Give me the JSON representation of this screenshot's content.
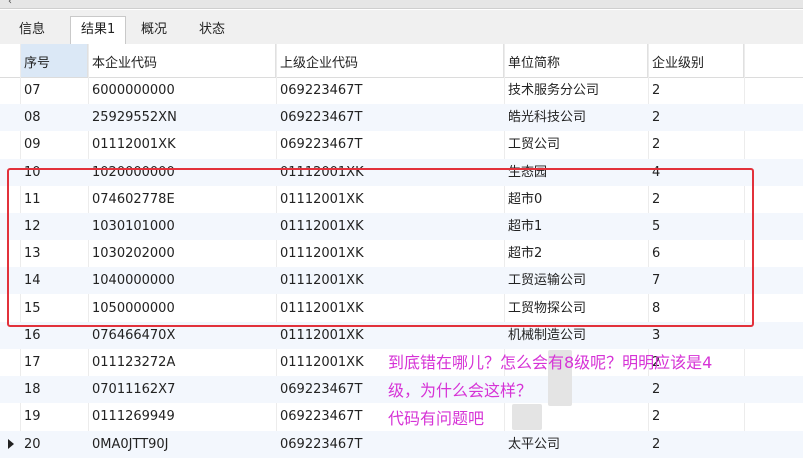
{
  "tabs": [
    {
      "label": "信息",
      "active": false
    },
    {
      "label": "结果1",
      "active": true
    },
    {
      "label": "概况",
      "active": false
    },
    {
      "label": "状态",
      "active": false
    }
  ],
  "table": {
    "columns": [
      "序号",
      "本企业代码",
      "上级企业代码",
      "单位简称",
      "企业级别"
    ],
    "rows": [
      [
        "07",
        "6000000000",
        "069223467T",
        "技术服务分公司",
        "2"
      ],
      [
        "08",
        "25929552XN",
        "069223467T",
        "皓光科技公司",
        "2"
      ],
      [
        "09",
        "01112001XK",
        "069223467T",
        "工贸公司",
        "2"
      ],
      [
        "10",
        "1020000000",
        "01112001XK",
        "生态园",
        "4"
      ],
      [
        "11",
        "074602778E",
        "01112001XK",
        "超市0",
        "2"
      ],
      [
        "12",
        "1030101000",
        "01112001XK",
        "超市1",
        "5"
      ],
      [
        "13",
        "1030202000",
        "01112001XK",
        "超市2",
        "6"
      ],
      [
        "14",
        "1040000000",
        "01112001XK",
        "工贸运输公司",
        "7"
      ],
      [
        "15",
        "1050000000",
        "01112001XK",
        "工贸物探公司",
        "8"
      ],
      [
        "16",
        "076466470X",
        "01112001XK",
        "机械制造公司",
        "3"
      ],
      [
        "17",
        "011123272A",
        "01112001XK",
        "",
        "2"
      ],
      [
        "18",
        "07011162X7",
        "069223467T",
        "",
        "2"
      ],
      [
        "19",
        "0111269949",
        "069223467T",
        "",
        "2"
      ],
      [
        "20",
        "0MA0JTT90J",
        "069223467T",
        "太平公司",
        "2"
      ]
    ]
  },
  "annotation": {
    "lines": [
      "到底错在哪儿？怎么会有8级呢？明明应该是4",
      "级，为什么会这样？",
      "代码有问题吧"
    ]
  },
  "colors": {
    "highlight_box": "#e2313b",
    "annotation_text": "#d633d6",
    "selected_header": "#dbe8f6",
    "alt_row": "#f3f7fd"
  }
}
